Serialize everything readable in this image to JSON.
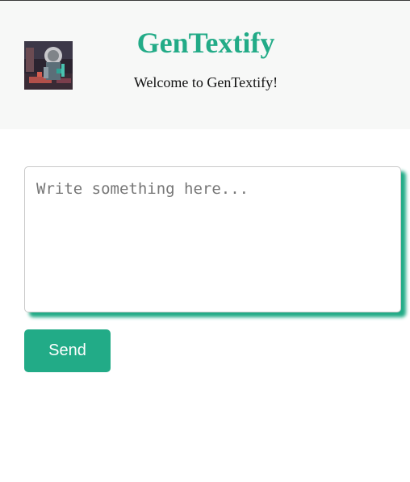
{
  "header": {
    "title": "GenTextify",
    "subtitle": "Welcome to GenTextify!",
    "logo_icon": "robot-avatar-icon"
  },
  "composer": {
    "placeholder": "Write something here...",
    "value": ""
  },
  "actions": {
    "send_label": "Send"
  },
  "colors": {
    "brand": "#22ab87",
    "header_bg": "#f7f8f7",
    "text": "#111111"
  }
}
